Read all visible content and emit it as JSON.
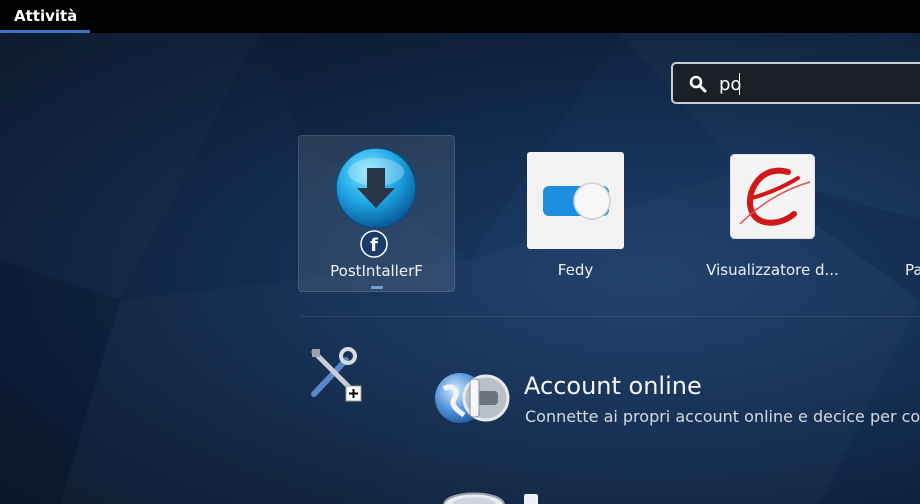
{
  "topbar": {
    "activities_label": "Attività"
  },
  "search": {
    "value": "po",
    "icon": "search-icon"
  },
  "apps": [
    {
      "label": "PostIntallerF",
      "icon": "download-arrow-icon",
      "selected": true,
      "running": true
    },
    {
      "label": "Fedy",
      "icon": "toggle-switch-icon",
      "selected": false,
      "running": false
    },
    {
      "label": "Visualizzatore d...",
      "icon": "document-viewer-icon",
      "selected": false,
      "running": false
    },
    {
      "label": "Pa",
      "icon": "partial-app-icon",
      "selected": false,
      "running": false
    }
  ],
  "provider": {
    "icon": "settings-tools-icon"
  },
  "results": [
    {
      "title": "Account online",
      "description": "Connette ai propri account online e decice per cosa",
      "icon": "online-accounts-icon"
    }
  ],
  "colors": {
    "topbar": "#000000",
    "accent": "#3b74c0",
    "background": "#143056"
  }
}
